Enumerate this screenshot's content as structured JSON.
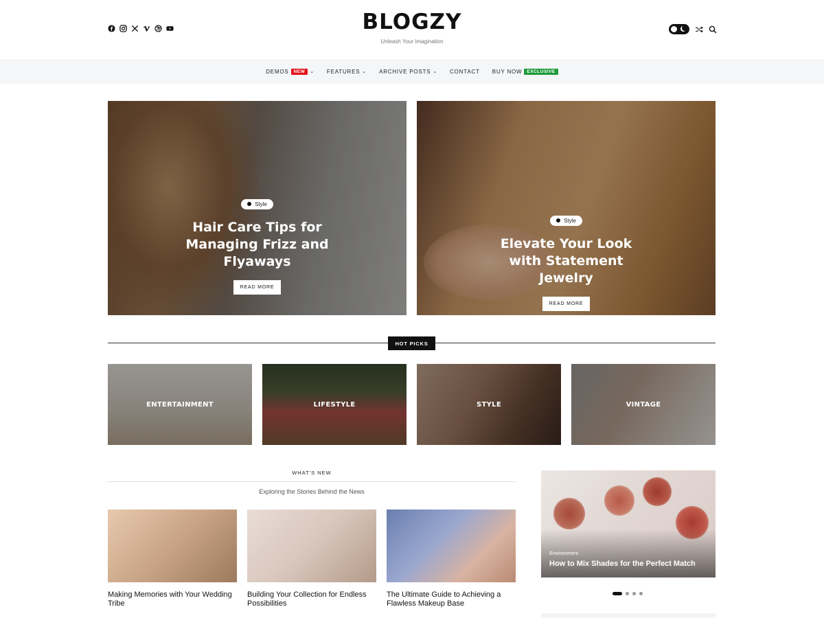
{
  "header": {
    "logo": "BLOGZY",
    "tagline": "Unleash Your Imagination",
    "social_icons": [
      "facebook-icon",
      "instagram-icon",
      "x-icon",
      "vimeo-icon",
      "dribbble-icon",
      "youtube-icon"
    ],
    "tool_icons": [
      "dark-mode-toggle",
      "shuffle-icon",
      "search-icon"
    ]
  },
  "nav": {
    "items": [
      {
        "label": "DEMOS",
        "badge": "NEW",
        "badge_color": "#e3141c",
        "dropdown": true
      },
      {
        "label": "FEATURES",
        "dropdown": true
      },
      {
        "label": "ARCHIVE POSTS",
        "dropdown": true
      },
      {
        "label": "CONTACT",
        "dropdown": false
      },
      {
        "label": "BUY NOW",
        "badge": "EXCLUSIVE",
        "badge_color": "#1e9b3a",
        "dropdown": false
      }
    ]
  },
  "hero": [
    {
      "category": "Style",
      "title": "Hair Care Tips for Managing Frizz and Flyaways",
      "button": "READ MORE"
    },
    {
      "category": "Style",
      "title": "Elevate Your Look with Statement Jewelry",
      "button": "READ MORE"
    }
  ],
  "hot_picks": {
    "label": "HOT PICKS",
    "tiles": [
      "ENTERTAINMENT",
      "LIFESTYLE",
      "STYLE",
      "VINTAGE"
    ]
  },
  "whats_new": {
    "title": "WHAT'S NEW",
    "subtitle": "Exploring the Stories Behind the News",
    "cards": [
      {
        "title": "Making Memories with Your Wedding Tribe"
      },
      {
        "title": "Building Your Collection for Endless Possibilities"
      },
      {
        "title": "The Ultimate Guide to Achieving a Flawless Makeup Base"
      }
    ]
  },
  "sidebar_slider": {
    "category": "Environment",
    "title": "How to Mix Shades for the Perfect Match",
    "slide_count": 4,
    "active_slide": 1
  }
}
